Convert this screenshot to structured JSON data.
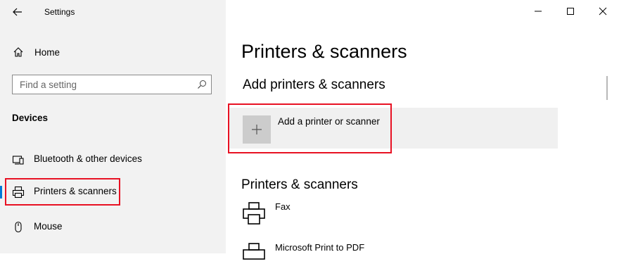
{
  "window": {
    "title": "Settings"
  },
  "sidebar": {
    "home_label": "Home",
    "search_placeholder": "Find a setting",
    "section_title": "Devices",
    "items": [
      {
        "label": "Bluetooth & other devices",
        "icon": "bluetooth-devices-icon"
      },
      {
        "label": "Printers & scanners",
        "icon": "printer-icon",
        "selected": true
      },
      {
        "label": "Mouse",
        "icon": "mouse-icon"
      }
    ]
  },
  "main": {
    "page_title": "Printers & scanners",
    "add_section_title": "Add printers & scanners",
    "add_button_label": "Add a printer or scanner",
    "list_title": "Printers & scanners",
    "printers": [
      {
        "name": "Fax"
      },
      {
        "name": "Microsoft Print to PDF"
      }
    ]
  },
  "colors": {
    "accent": "#0078d7",
    "highlight": "#e81123",
    "sidebar_bg": "#f2f2f2"
  }
}
